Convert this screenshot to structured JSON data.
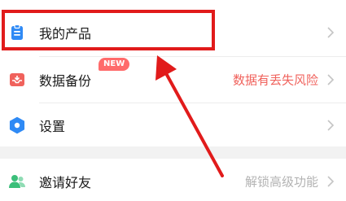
{
  "menu": {
    "items": [
      {
        "label": "我的产品",
        "value": "",
        "icon": "clipboard-icon"
      },
      {
        "label": "数据备份",
        "value": "数据有丢失风险",
        "icon": "backup-icon",
        "badge": "NEW"
      },
      {
        "label": "设置",
        "value": "",
        "icon": "gear-icon"
      },
      {
        "label": "邀请好友",
        "value": "解锁高级功能",
        "icon": "invite-users-icon"
      }
    ]
  },
  "colors": {
    "accent_blue": "#2f8af5",
    "backup_red": "#f0625c",
    "invite_green": "#3bbf7a",
    "warning_text": "#f0625c",
    "muted_text": "#b3b3b3",
    "annotation_red": "#e11b1b"
  }
}
